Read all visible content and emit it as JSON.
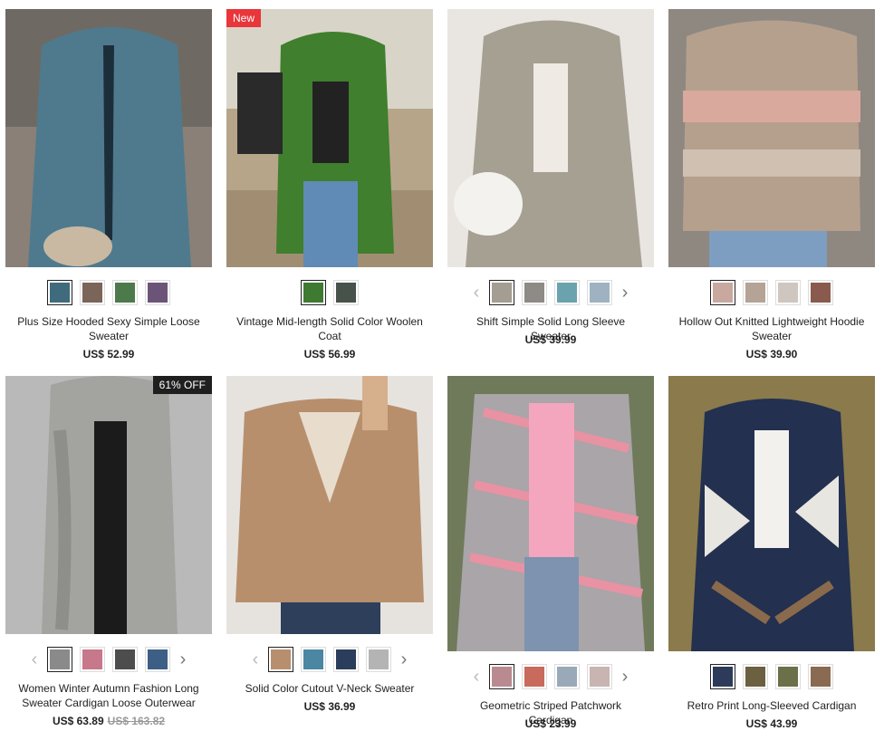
{
  "products": [
    {
      "title": "Plus Size Hooded Sexy Simple Loose Sweater",
      "price": "US$ 52.99",
      "image": "blue knitted lace-up hoodie sweater",
      "swatches": [
        "#3f6b7c",
        "#7b6458",
        "#4d7a4a",
        "#6b5478"
      ]
    },
    {
      "title": "Vintage Mid-length Solid Color Woolen Coat",
      "price": "US$ 56.99",
      "badge": "New",
      "image": "green woolen coat with plaid scarf",
      "swatches": [
        "#3f7a33",
        "#47524a"
      ]
    },
    {
      "title": "Shift Simple Solid Long Sleeve Sweater",
      "price": "US$ 39.99",
      "image": "beige hooded long cardigan with white bag",
      "swatches": [
        "#a39d92",
        "#8e8b86",
        "#6aa3ad",
        "#9fb2c1"
      ]
    },
    {
      "title": "Hollow Out Knitted Lightweight Hoodie Sweater",
      "price": "US$ 39.90",
      "image": "striped pink knitted hoodie",
      "swatches": [
        "#c9a8a0",
        "#b5a395",
        "#cfc6c0",
        "#8a5a4e"
      ]
    },
    {
      "title": "Women Winter Autumn Fashion Long Sweater Cardigan Loose Outerwear",
      "price": "US$ 63.89",
      "old_price": "US$ 163.82",
      "badge": "61% OFF",
      "image": "grey cable knit long cardigan",
      "swatches": [
        "#8a8a8a",
        "#c7788a",
        "#4d4d4d",
        "#3d5f86"
      ]
    },
    {
      "title": "Solid Color Cutout V-Neck Sweater",
      "price": "US$ 36.99",
      "image": "tan cutout v-neck sweater",
      "swatches": [
        "#b78f6f",
        "#4b87a3",
        "#2b3d5c",
        "#b4b4b4"
      ]
    },
    {
      "title": "Geometric Striped Patchwork Cardigan",
      "price": "US$ 23.99",
      "image": "pink geometric patchwork cardigan",
      "swatches": [
        "#b98a8f",
        "#c86a5c",
        "#9aa9b8",
        "#c8b4b0"
      ]
    },
    {
      "title": "Retro Print Long-Sleeved Cardigan",
      "price": "US$ 43.99",
      "image": "navy aztec print cardigan",
      "swatches": [
        "#2d3a5a",
        "#6b6040",
        "#6b7048",
        "#8a6a50"
      ]
    }
  ],
  "arrows": {
    "prev": "‹",
    "next": "›"
  }
}
